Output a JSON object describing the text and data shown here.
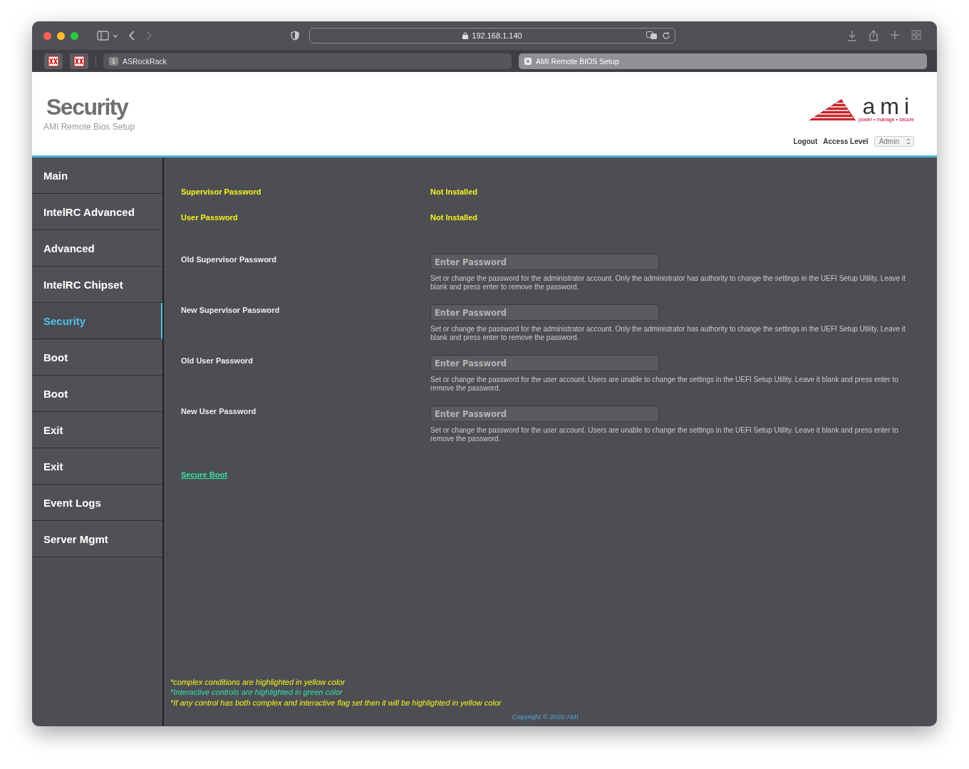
{
  "browser": {
    "address": "192.168.1.140",
    "tabs": [
      {
        "label": "ASRockRack",
        "number": "1",
        "selected": false
      },
      {
        "label": "AMI Remote BIOS Setup",
        "selected": true
      }
    ]
  },
  "header": {
    "title": "Security",
    "subtitle": "AMI Remote Bios Setup",
    "logo_text": "ami",
    "logo_tagline": "power • manage • secure",
    "logout": "Logout",
    "access_label": "Access Level",
    "access_value": "Admin"
  },
  "sidebar": {
    "items": [
      {
        "label": "Main",
        "selected": false
      },
      {
        "label": "IntelRC Advanced",
        "selected": false
      },
      {
        "label": "Advanced",
        "selected": false
      },
      {
        "label": "IntelRC Chipset",
        "selected": false
      },
      {
        "label": "Security",
        "selected": true
      },
      {
        "label": "Boot",
        "selected": false
      },
      {
        "label": "Boot",
        "selected": false
      },
      {
        "label": "Exit",
        "selected": false
      },
      {
        "label": "Exit",
        "selected": false
      },
      {
        "label": "Event Logs",
        "selected": false
      },
      {
        "label": "Server Mgmt",
        "selected": false
      }
    ]
  },
  "status_rows": [
    {
      "label": "Supervisor Password",
      "value": "Not Installed",
      "kind": "complex"
    },
    {
      "label": "User Password",
      "value": "Not Installed",
      "kind": "complex"
    }
  ],
  "fields": [
    {
      "label": "Old Supervisor Password",
      "placeholder": "Enter Password",
      "help": "Set or change the password for the administrator account. Only the administrator has authority to change the settings in the UEFI Setup Utility. Leave it blank and press enter to remove the password."
    },
    {
      "label": "New Supervisor Password",
      "placeholder": "Enter Password",
      "help": "Set or change the password for the administrator account. Only the administrator has authority to change the settings in the UEFI Setup Utility. Leave it blank and press enter to remove the password."
    },
    {
      "label": "Old User Password",
      "placeholder": "Enter Password",
      "help": "Set or change the password for the user account. Users are unable to change the settings in the UEFI Setup Utility. Leave it blank and press enter to remove the password."
    },
    {
      "label": "New User Password",
      "placeholder": "Enter Password",
      "help": "Set or change the password for the user account. Users are unable to change the settings in the UEFI Setup Utility. Leave it blank and press enter to remove the password."
    }
  ],
  "link": {
    "label": "Secure Boot",
    "kind": "interactive"
  },
  "notes": [
    {
      "text": "*complex conditions are highlighted in yellow color",
      "kind": "complex"
    },
    {
      "text": "*Interactive controls are highlighted in green color",
      "kind": "interactive"
    },
    {
      "text": "*If any control has both complex and interactive flag set then it will be highlighted in yellow color",
      "kind": "complex"
    }
  ],
  "copyright": "Copyright © 2020 AMI"
}
